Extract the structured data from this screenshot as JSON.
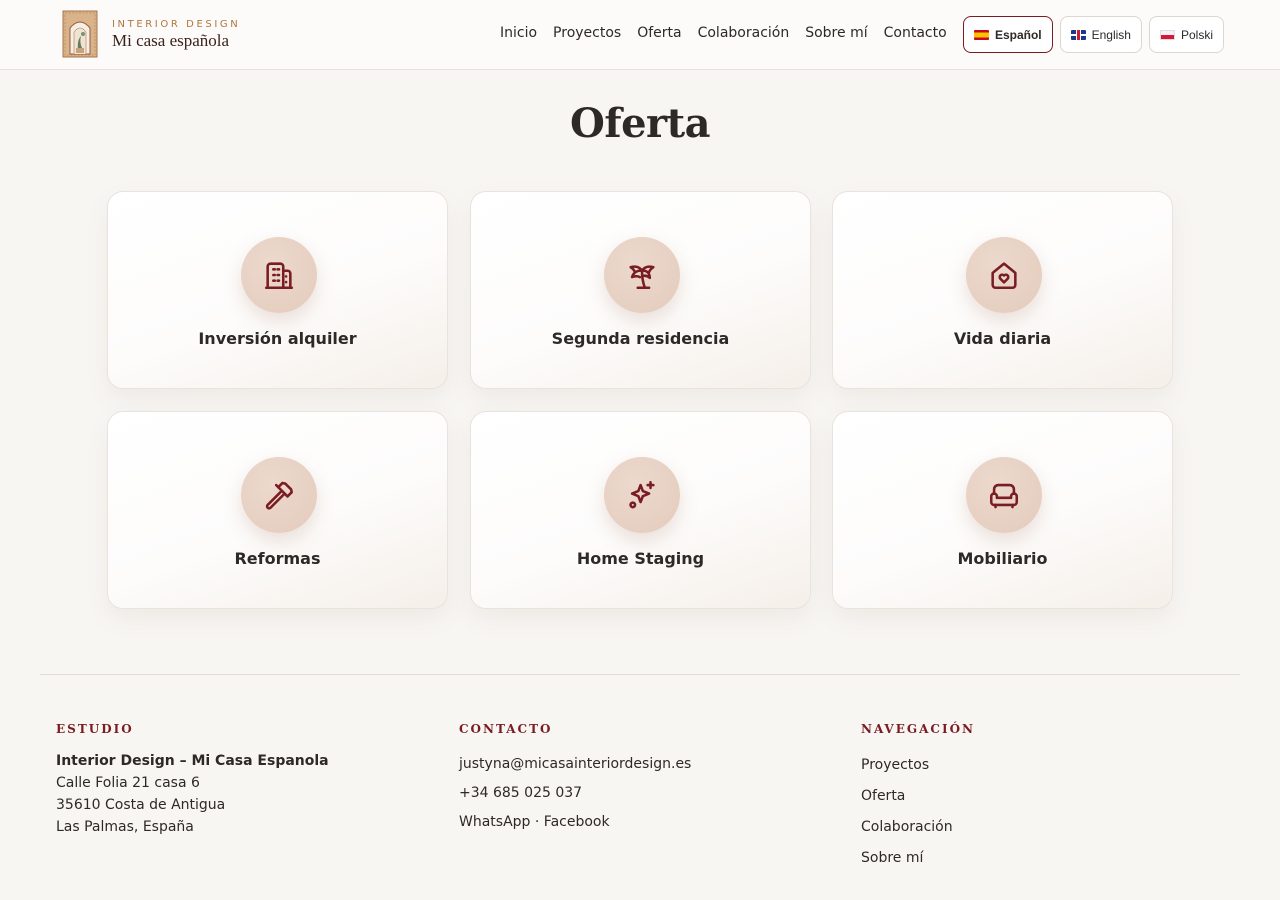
{
  "brand": {
    "tag": "INTERIOR DESIGN",
    "name": "Mi casa española"
  },
  "nav": {
    "links": [
      "Inicio",
      "Proyectos",
      "Oferta",
      "Colaboración",
      "Sobre mí",
      "Contacto"
    ]
  },
  "languages": [
    {
      "label": "Español",
      "flag": "spain-flag-icon",
      "active": true
    },
    {
      "label": "English",
      "flag": "uk-flag-icon",
      "active": false
    },
    {
      "label": "Polski",
      "flag": "poland-flag-icon",
      "active": false
    }
  ],
  "page": {
    "title": "Oferta"
  },
  "offers": [
    {
      "label": "Inversión alquiler",
      "icon": "building-icon"
    },
    {
      "label": "Segunda residencia",
      "icon": "palm-tree-icon"
    },
    {
      "label": "Vida diaria",
      "icon": "home-heart-icon"
    },
    {
      "label": "Reformas",
      "icon": "hammer-icon"
    },
    {
      "label": "Home Staging",
      "icon": "sparkles-icon"
    },
    {
      "label": "Mobiliario",
      "icon": "sofa-icon"
    }
  ],
  "footer": {
    "studio": {
      "heading": "ESTUDIO",
      "lines": [
        "Interior Design – Mi Casa Espanola",
        "Calle Folia 21 casa 6",
        "35610 Costa de Antigua",
        "Las Palmas, España"
      ]
    },
    "contact": {
      "heading": "CONTACTO",
      "email": "justyna@micasainteriordesign.es",
      "phone": "+34 685 025 037",
      "whatsapp": "WhatsApp",
      "separator": "·",
      "facebook": "Facebook"
    },
    "navigation": {
      "heading": "NAVEGACIÓN",
      "links": [
        "Proyectos",
        "Oferta",
        "Colaboración",
        "Sobre mí"
      ]
    }
  },
  "colors": {
    "accent": "#7a1d22",
    "background": "#f8f6f3",
    "icon_circle": "#e6cfc1",
    "brand_tag": "#b0763f"
  }
}
